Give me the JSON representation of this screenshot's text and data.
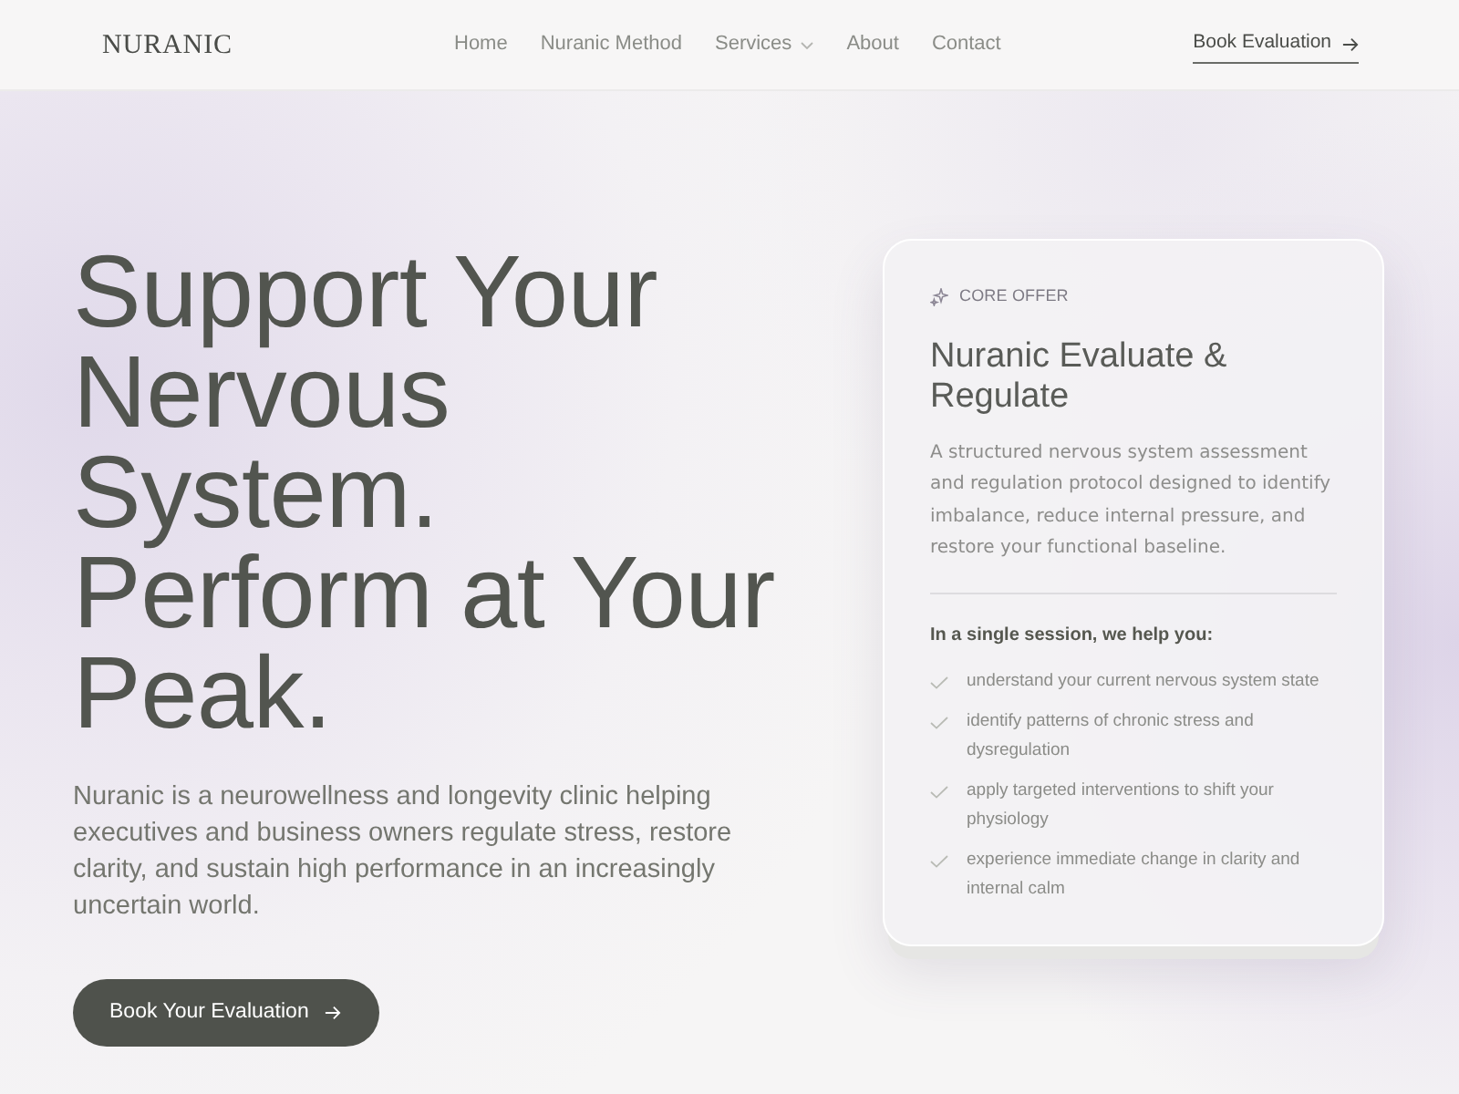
{
  "nav": {
    "logo": "NURANIC",
    "links": [
      {
        "label": "Home",
        "dropdown": false
      },
      {
        "label": "Nuranic Method",
        "dropdown": false
      },
      {
        "label": "Services",
        "dropdown": true
      },
      {
        "label": "About",
        "dropdown": false
      },
      {
        "label": "Contact",
        "dropdown": false
      }
    ],
    "cta": "Book Evaluation"
  },
  "hero": {
    "headline": [
      "Support Your Nervous System.",
      "Perform at Your Peak."
    ],
    "description": "Nuranic is a neurowellness and longevity clinic helping executives and business owners regulate stress, restore clarity, and sustain high performance in an increasingly uncertain world.",
    "button": "Book Your Evaluation"
  },
  "offer_card": {
    "eyebrow": "CORE OFFER",
    "title": "Nuranic Evaluate & Regulate",
    "description": "A structured nervous system assessment and regulation protocol designed to identify imbalance, reduce internal pressure, and restore your functional baseline.",
    "list_heading": "In a single session, we help you:",
    "benefits": [
      "understand your current nervous system state",
      "identify patterns of chronic stress and dysregulation",
      "apply targeted interventions to shift your physiology",
      "experience immediate change in clarity and internal calm"
    ]
  }
}
